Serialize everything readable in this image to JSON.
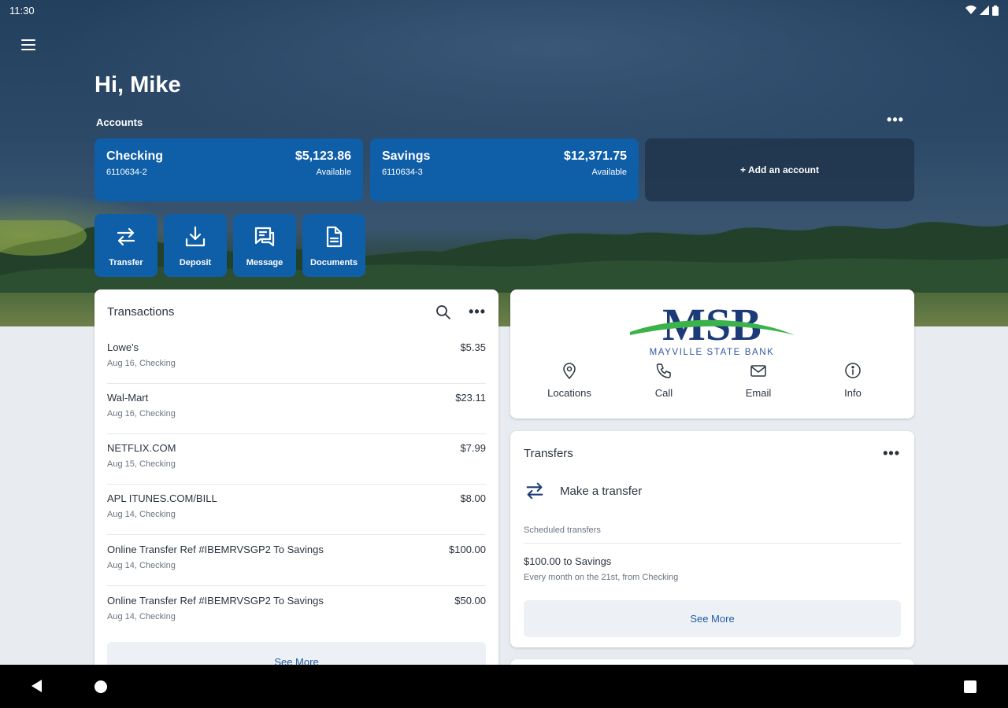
{
  "status_bar": {
    "time": "11:30"
  },
  "greeting": "Hi, Mike",
  "accounts": {
    "label": "Accounts",
    "items": [
      {
        "name": "Checking",
        "number": "6110634-2",
        "amount": "$5,123.86",
        "available_label": "Available"
      },
      {
        "name": "Savings",
        "number": "6110634-3",
        "amount": "$12,371.75",
        "available_label": "Available"
      }
    ],
    "add_label": "+ Add an account"
  },
  "quick_actions": [
    {
      "label": "Transfer",
      "icon": "transfer-icon"
    },
    {
      "label": "Deposit",
      "icon": "deposit-icon"
    },
    {
      "label": "Message",
      "icon": "message-icon"
    },
    {
      "label": "Documents",
      "icon": "document-icon"
    }
  ],
  "transactions": {
    "title": "Transactions",
    "items": [
      {
        "desc": "Lowe's",
        "sub": "Aug 16, Checking",
        "amount": "$5.35"
      },
      {
        "desc": "Wal-Mart",
        "sub": "Aug 16, Checking",
        "amount": "$23.11"
      },
      {
        "desc": "NETFLIX.COM",
        "sub": "Aug 15, Checking",
        "amount": "$7.99"
      },
      {
        "desc": "APL ITUNES.COM/BILL",
        "sub": "Aug 14, Checking",
        "amount": "$8.00"
      },
      {
        "desc": "Online Transfer Ref #IBEMRVSGP2 To Savings",
        "sub": "Aug 14, Checking",
        "amount": "$100.00"
      },
      {
        "desc": "Online Transfer Ref #IBEMRVSGP2 To Savings",
        "sub": "Aug 14, Checking",
        "amount": "$50.00"
      }
    ],
    "see_more": "See More"
  },
  "bank": {
    "logo_text": "MSB",
    "logo_subtext": "MAYVILLE STATE BANK",
    "actions": [
      {
        "label": "Locations",
        "icon": "location-pin-icon"
      },
      {
        "label": "Call",
        "icon": "phone-icon"
      },
      {
        "label": "Email",
        "icon": "email-icon"
      },
      {
        "label": "Info",
        "icon": "info-icon"
      }
    ]
  },
  "transfers": {
    "title": "Transfers",
    "make_transfer": "Make a transfer",
    "scheduled_label": "Scheduled transfers",
    "scheduled": {
      "title": "$100.00 to Savings",
      "sub": "Every month on the 21st, from Checking"
    },
    "see_more": "See More"
  },
  "colors": {
    "brand_blue": "#0f5ea8",
    "logo_navy": "#1c3a78",
    "logo_green": "#3bb24a",
    "link": "#1f5fa8"
  }
}
